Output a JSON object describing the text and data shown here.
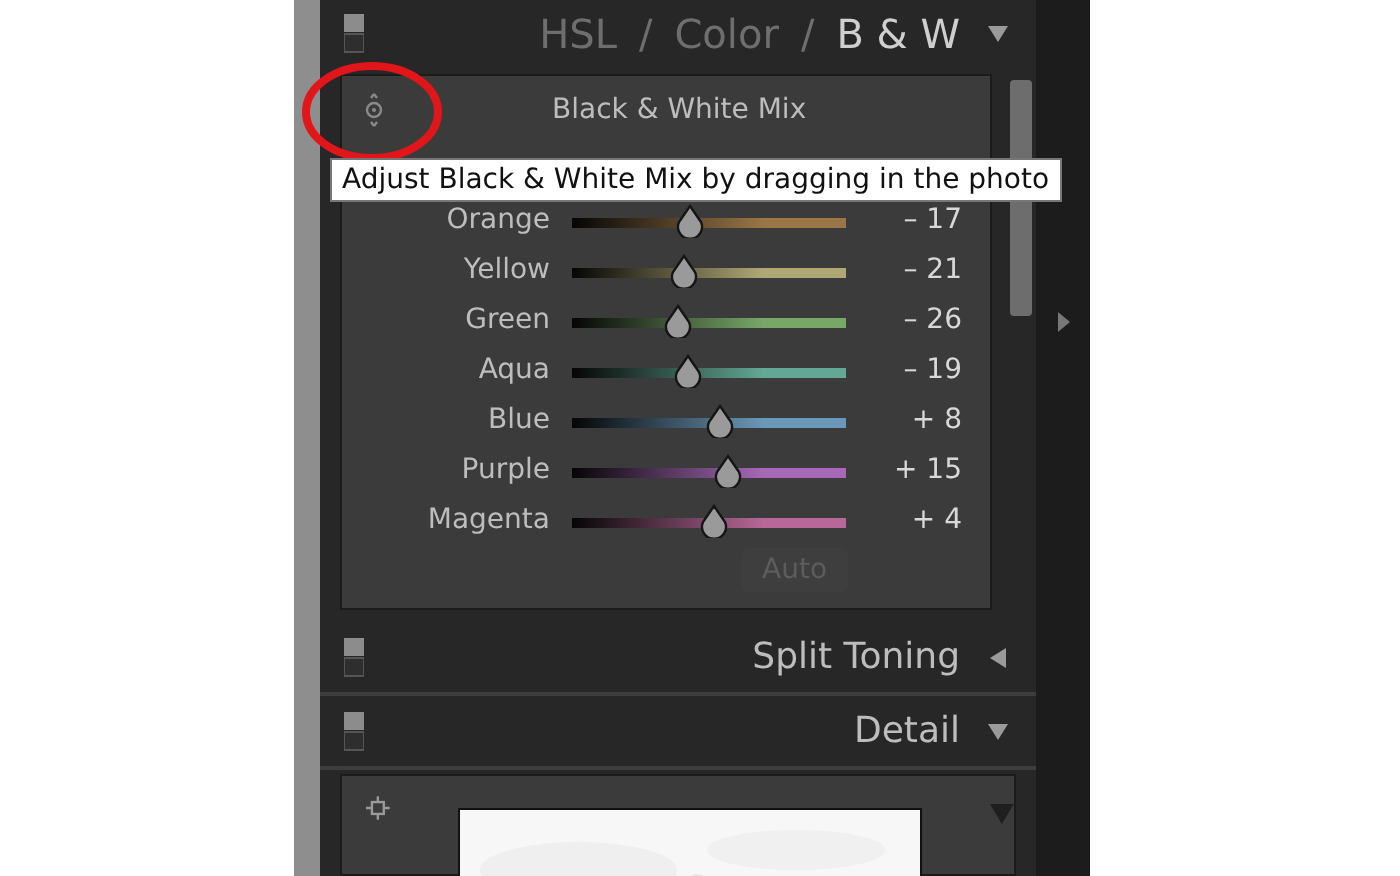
{
  "header": {
    "tabs": [
      {
        "label": "HSL",
        "selected": false
      },
      {
        "label": "Color",
        "selected": false
      },
      {
        "label": "B & W",
        "selected": true
      }
    ],
    "separators": [
      "/",
      "/"
    ],
    "expanded": true
  },
  "bw_mix": {
    "title": "Black & White Mix",
    "channels": [
      {
        "name": "Orange",
        "level": 0.43,
        "reading": "– 17",
        "color": "#9a7646"
      },
      {
        "name": "Yellow",
        "level": 0.41,
        "reading": "– 21",
        "color": "#b0a874"
      },
      {
        "name": "Green",
        "level": 0.385,
        "reading": "– 26",
        "color": "#78a868"
      },
      {
        "name": "Aqua",
        "level": 0.42,
        "reading": "– 19",
        "color": "#62a894"
      },
      {
        "name": "Blue",
        "level": 0.54,
        "reading": "+ 8",
        "color": "#6a98b8"
      },
      {
        "name": "Purple",
        "level": 0.57,
        "reading": "+ 15",
        "color": "#a868b8"
      },
      {
        "name": "Magenta",
        "level": 0.52,
        "reading": "+ 4",
        "color": "#b86898"
      }
    ],
    "auto_button": {
      "label": "Auto",
      "disabled": true
    }
  },
  "tooltip": {
    "text": "Adjust Black & White Mix by dragging in the photo"
  },
  "panels": [
    {
      "title": "Split Toning",
      "expanded": false
    },
    {
      "title": "Detail",
      "expanded": true
    }
  ]
}
